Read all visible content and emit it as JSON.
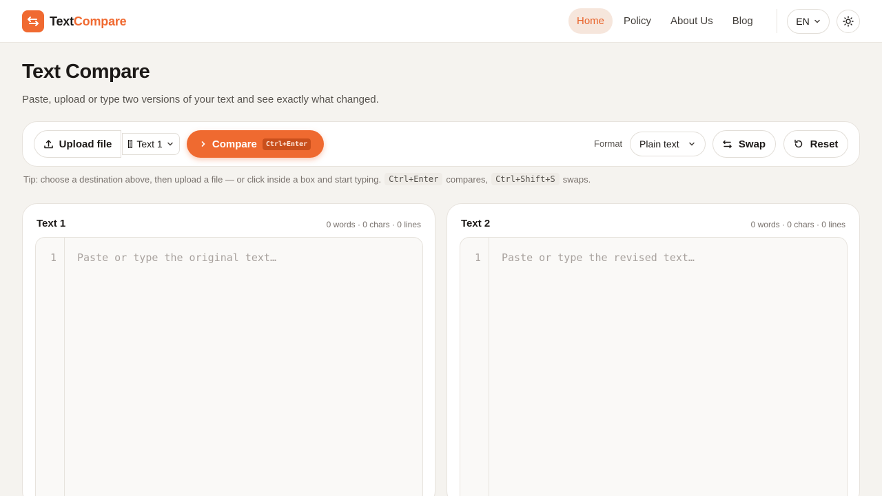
{
  "brand": {
    "name_part1": "Text",
    "name_part2": "Compare",
    "accent": "#f06a31"
  },
  "nav": {
    "items": [
      {
        "label": "Home",
        "active": true
      },
      {
        "label": "Policy"
      },
      {
        "label": "About Us"
      },
      {
        "label": "Blog"
      }
    ],
    "language": "EN",
    "theme_icon": "sun-icon"
  },
  "page": {
    "title": "Text Compare",
    "subtitle": "Paste, upload or type two versions of your text and see exactly what changed."
  },
  "toolbar": {
    "upload_label": "Upload file",
    "target_label": "Text 1",
    "compare_label": "Compare",
    "compare_shortcut": "Ctrl+Enter",
    "format_label": "Format",
    "format_value": "Plain text",
    "swap_label": "Swap",
    "reset_label": "Reset"
  },
  "tip": {
    "text_before": "Tip: choose a destination above, then upload a file — or click inside a box and start typing.",
    "kbd1": "Ctrl+Enter",
    "text_middle": "compares,",
    "kbd2": "Ctrl+Shift+S",
    "text_after": "swaps."
  },
  "panels": [
    {
      "title": "Text 1",
      "stats": "0 words · 0 chars · 0 lines",
      "line_number": "1",
      "placeholder": "Paste or type the original text…"
    },
    {
      "title": "Text 2",
      "stats": "0 words · 0 chars · 0 lines",
      "line_number": "1",
      "placeholder": "Paste or type the revised text…"
    }
  ]
}
